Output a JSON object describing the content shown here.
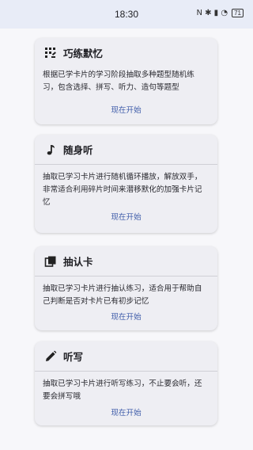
{
  "status_bar": {
    "time": "18:30",
    "icons": "N ✱ ▮ ◔",
    "battery": "71"
  },
  "cards": [
    {
      "title": "巧练默忆",
      "icon": "dice-grid-icon",
      "description": "根据已学卡片的学习阶段抽取多种题型随机练习，包含选择、拼写、听力、造句等题型",
      "action": "现在开始"
    },
    {
      "title": "随身听",
      "icon": "music-note-icon",
      "description": "抽取已学习卡片进行随机循环播放，解放双手，非常适合利用碎片时间来潜移默化的加强卡片记忆",
      "action": "现在开始"
    },
    {
      "title": "抽认卡",
      "icon": "card-stack-icon",
      "description": "抽取已学习卡片进行抽认练习，适合用于帮助自己判断是否对卡片已有初步记忆",
      "action": "现在开始"
    },
    {
      "title": "听写",
      "icon": "pencil-icon",
      "description": "抽取已学习卡片进行听写练习，不止要会听，还要会拼写哦",
      "action": "现在开始"
    }
  ]
}
